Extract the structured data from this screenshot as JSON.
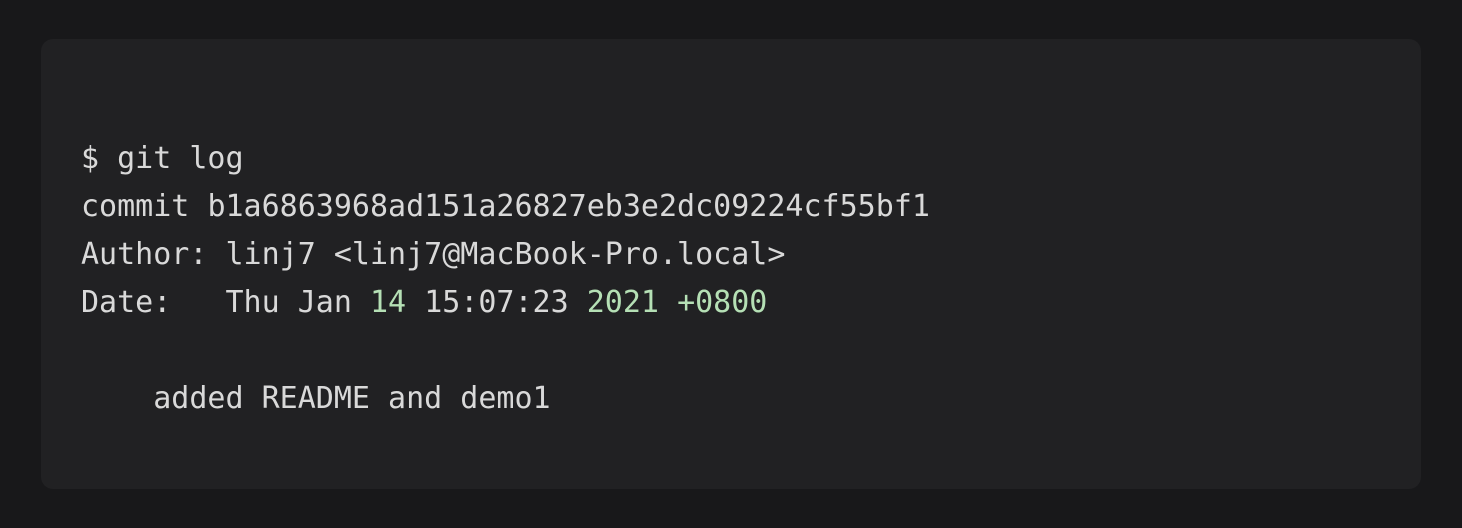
{
  "terminal": {
    "prompt": "$ ",
    "command": "git log",
    "output": {
      "commit_prefix": "commit ",
      "commit_hash": "b1a6863968ad151a26827eb3e2dc09224cf55bf1",
      "author_prefix": "Author: ",
      "author_value": "linj7 <linj7@MacBook-Pro.local>",
      "date_prefix": "Date:   ",
      "date_weekday": "Thu ",
      "date_month": "Jan ",
      "date_day": "14",
      "date_sep1": " ",
      "date_time": "15:07:23",
      "date_sep2": " ",
      "date_year": "2021",
      "date_sep3": " ",
      "date_tz": "+0800",
      "message_indent": "    ",
      "message": "added README and demo1"
    }
  }
}
